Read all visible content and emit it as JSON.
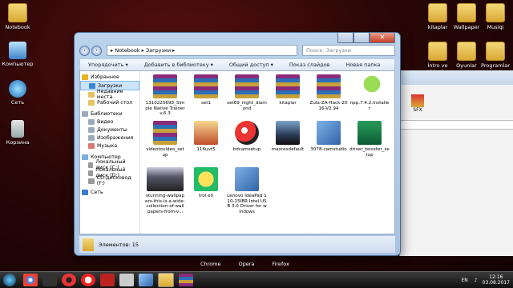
{
  "desktop": {
    "left_icons": [
      "Notebook",
      "Компьютер",
      "Сеть",
      "Корзина"
    ],
    "right_icons": [
      "kitaplar",
      "Wallpaper",
      "Musiqi",
      "İntro ve Videolar",
      "Oyunlar",
      "Programlar"
    ]
  },
  "background_window": {
    "tile_label": "SFX"
  },
  "explorer": {
    "address": "▸ Notebook ▸ Загрузки ▸",
    "search_placeholder": "Поиск: Загрузки",
    "toolbar": [
      "Упорядочить ▾",
      "Добавить в библиотеку ▾",
      "Общий доступ ▾",
      "Показ слайдов",
      "Новая папка"
    ],
    "nav": [
      {
        "label": "Избранное",
        "type": "star"
      },
      {
        "label": "Загрузки",
        "type": "dl",
        "selected": true
      },
      {
        "label": "Недавние места",
        "type": "fol"
      },
      {
        "label": "Рабочий стол",
        "type": "fol"
      },
      {
        "label": "Библиотеки",
        "type": "lib"
      },
      {
        "label": "Видео",
        "type": "lib"
      },
      {
        "label": "Документы",
        "type": "lib"
      },
      {
        "label": "Изображения",
        "type": "lib"
      },
      {
        "label": "Музыка",
        "type": "note"
      },
      {
        "label": "Компьютер",
        "type": "pc"
      },
      {
        "label": "Локальный диск (C:)",
        "type": "disk"
      },
      {
        "label": "Локальный диск (D:)",
        "type": "disk"
      },
      {
        "label": "CD-дисковод (F:)",
        "type": "disk"
      },
      {
        "label": "Сеть",
        "type": "net"
      }
    ],
    "files": [
      {
        "name": "1310225693_Simple Native Trainer v.6.3",
        "kind": "rar"
      },
      {
        "name": "set1",
        "kind": "rar"
      },
      {
        "name": "set69_night_diamond",
        "kind": "rar"
      },
      {
        "name": "kitaplar",
        "kind": "rar"
      },
      {
        "name": "Zula-ZA-Hack-2016-V2.94",
        "kind": "rar"
      },
      {
        "name": "npp.7.4.2.Installer",
        "kind": "snake"
      },
      {
        "name": "videotovideo_setup",
        "kind": "rar"
      },
      {
        "name": "116uvt5",
        "kind": "text-logo"
      },
      {
        "name": "bdcamsetup",
        "kind": "redball"
      },
      {
        "name": "maxresdefault",
        "kind": "photo"
      },
      {
        "name": "3078-camstudio",
        "kind": "installer"
      },
      {
        "name": "driver_booster_setup",
        "kind": "green"
      },
      {
        "name": "stunning-wallpapers-this-is-a-wide-collection-of-wallpapers-from-v...",
        "kind": "wallpaper"
      },
      {
        "name": "trol e0",
        "kind": "troll"
      },
      {
        "name": "Lenovo IdeaPad 110-15IBR Intel USB 3.0 Driver for windows",
        "kind": "installer"
      }
    ],
    "status_text": "Элементов: 15"
  },
  "shortcut_labels": [
    "Chrome",
    "Opera",
    "Firefox"
  ],
  "taskbar": {
    "lang": "EN",
    "time": "12:16",
    "date": "03.08.2017"
  }
}
